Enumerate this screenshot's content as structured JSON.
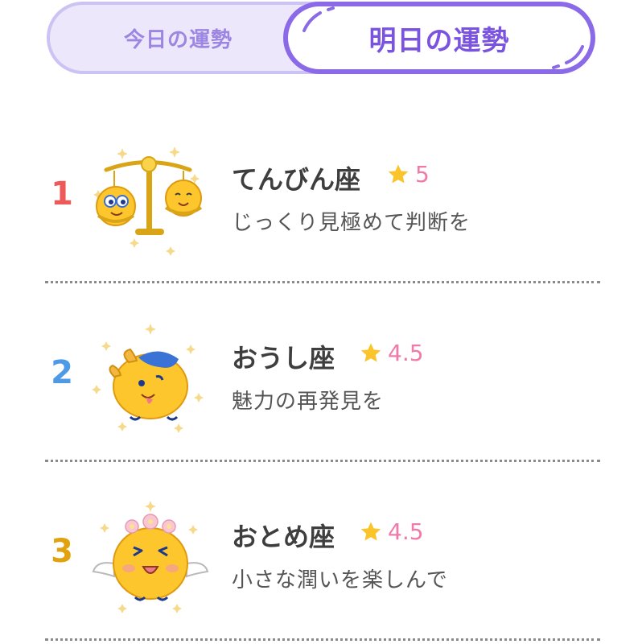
{
  "tabs": {
    "today": "今日の運勢",
    "tomorrow": "明日の運勢",
    "accent": "#8b6ae8"
  },
  "ranking": [
    {
      "rank": "1",
      "sign": "てんびん座",
      "stars": "5",
      "message": "じっくり見極めて判断を",
      "icon": "libra-scale-icon",
      "color": "#ee5a5a"
    },
    {
      "rank": "2",
      "sign": "おうし座",
      "stars": "4.5",
      "message": "魅力の再発見を",
      "icon": "taurus-bull-icon",
      "color": "#4e9ae6"
    },
    {
      "rank": "3",
      "sign": "おとめ座",
      "stars": "4.5",
      "message": "小さな潤いを楽しんで",
      "icon": "virgo-angel-icon",
      "color": "#e0a20e"
    }
  ],
  "colors": {
    "star": "#fbc42b",
    "score": "#f07aa8",
    "text": "#3e3e3e"
  }
}
